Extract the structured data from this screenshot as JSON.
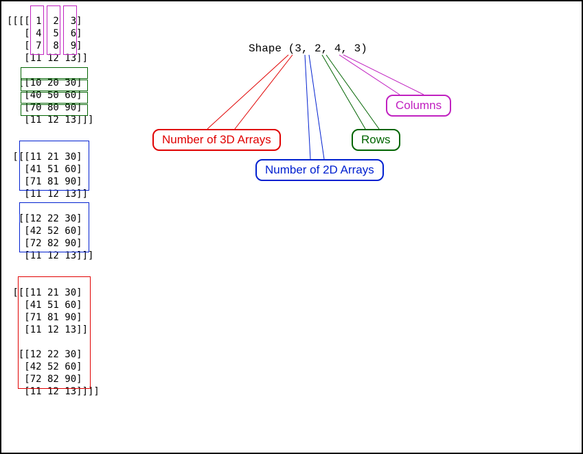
{
  "shape_text": "Shape (3, 2, 4, 3)",
  "callouts": {
    "n3d": "Number of 3D Arrays",
    "n2d": "Number of 2D Arrays",
    "rows": "Rows",
    "cols": "Columns"
  },
  "code_text": "[[[[ 1  2  3]\n   [ 4  5  6]\n   [ 7  8  9]\n   [11 12 13]]\n\n  [[10 20 30]\n   [40 50 60]\n   [70 80 90]\n   [11 12 13]]]\n\n\n [[[11 21 30]\n   [41 51 60]\n   [71 81 90]\n   [11 12 13]]\n\n  [[12 22 30]\n   [42 52 60]\n   [72 82 90]\n   [11 12 13]]]\n\n\n [[[11 21 30]\n   [41 51 60]\n   [71 81 90]\n   [11 12 13]]\n\n  [[12 22 30]\n   [42 52 60]\n   [72 82 90]\n   [11 12 13]]]]",
  "chart_data": {
    "type": "table",
    "title": "4D NumPy array with shape (3, 2, 4, 3) illustrating dimension meanings",
    "shape": [
      3,
      2,
      4,
      3
    ],
    "dimension_labels": [
      "Number of 3D Arrays",
      "Number of 2D Arrays",
      "Rows",
      "Columns"
    ],
    "array": [
      [
        [
          [
            1,
            2,
            3
          ],
          [
            4,
            5,
            6
          ],
          [
            7,
            8,
            9
          ],
          [
            11,
            12,
            13
          ]
        ],
        [
          [
            10,
            20,
            30
          ],
          [
            40,
            50,
            60
          ],
          [
            70,
            80,
            90
          ],
          [
            11,
            12,
            13
          ]
        ]
      ],
      [
        [
          [
            11,
            21,
            30
          ],
          [
            41,
            51,
            60
          ],
          [
            71,
            81,
            90
          ],
          [
            11,
            12,
            13
          ]
        ],
        [
          [
            12,
            22,
            30
          ],
          [
            42,
            52,
            60
          ],
          [
            72,
            82,
            90
          ],
          [
            11,
            12,
            13
          ]
        ]
      ],
      [
        [
          [
            11,
            21,
            30
          ],
          [
            41,
            51,
            60
          ],
          [
            71,
            81,
            90
          ],
          [
            11,
            12,
            13
          ]
        ],
        [
          [
            12,
            22,
            30
          ],
          [
            42,
            52,
            60
          ],
          [
            72,
            82,
            90
          ],
          [
            11,
            12,
            13
          ]
        ]
      ]
    ],
    "highlight_colors": {
      "columns_example": "magenta",
      "rows_example": "green",
      "2d_arrays_example": "blue",
      "3d_array_example": "red"
    }
  }
}
